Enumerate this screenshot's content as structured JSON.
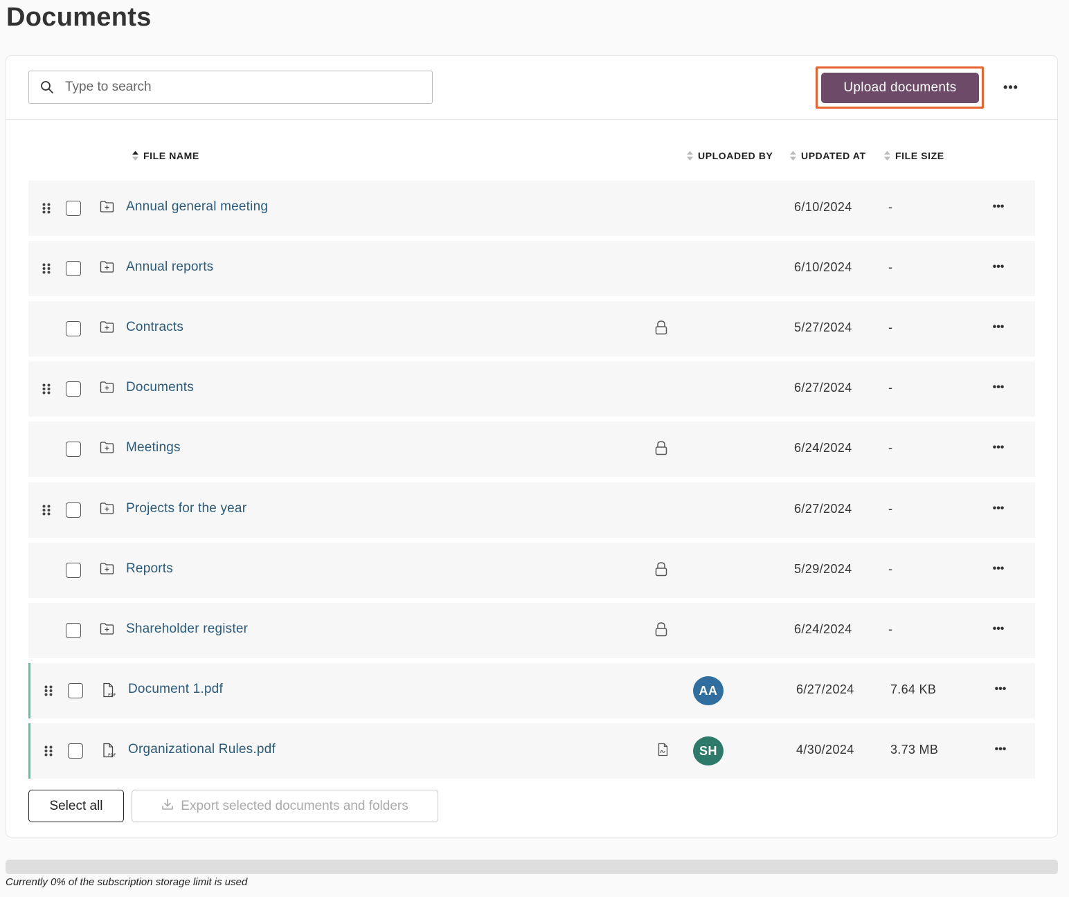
{
  "page": {
    "title": "Documents"
  },
  "toolbar": {
    "search_placeholder": "Type to search",
    "upload_label": "Upload documents",
    "more_label": "•••"
  },
  "table": {
    "columns": {
      "file_name": "FILE NAME",
      "uploaded_by": "UPLOADED BY",
      "updated_at": "UPDATED AT",
      "file_size": "FILE SIZE"
    },
    "rows": [
      {
        "name": "Annual general meeting",
        "type": "folder",
        "draggable": true,
        "locked": false,
        "uploaded_by": "",
        "updated_at": "6/10/2024",
        "size": "-"
      },
      {
        "name": "Annual reports",
        "type": "folder",
        "draggable": true,
        "locked": false,
        "uploaded_by": "",
        "updated_at": "6/10/2024",
        "size": "-"
      },
      {
        "name": "Contracts",
        "type": "folder",
        "draggable": false,
        "locked": true,
        "uploaded_by": "",
        "updated_at": "5/27/2024",
        "size": "-"
      },
      {
        "name": "Documents",
        "type": "folder",
        "draggable": true,
        "locked": false,
        "uploaded_by": "",
        "updated_at": "6/27/2024",
        "size": "-"
      },
      {
        "name": "Meetings",
        "type": "folder",
        "draggable": false,
        "locked": true,
        "uploaded_by": "",
        "updated_at": "6/24/2024",
        "size": "-"
      },
      {
        "name": "Projects for the year",
        "type": "folder",
        "draggable": true,
        "locked": false,
        "uploaded_by": "",
        "updated_at": "6/27/2024",
        "size": "-"
      },
      {
        "name": "Reports",
        "type": "folder",
        "draggable": false,
        "locked": true,
        "uploaded_by": "",
        "updated_at": "5/29/2024",
        "size": "-"
      },
      {
        "name": "Shareholder register",
        "type": "folder",
        "draggable": false,
        "locked": true,
        "uploaded_by": "",
        "updated_at": "6/24/2024",
        "size": "-"
      },
      {
        "name": "Document 1.pdf",
        "type": "pdf",
        "draggable": true,
        "locked": false,
        "uploaded_by": "AA",
        "avatar_color": "#2f6e9e",
        "updated_at": "6/27/2024",
        "size": "7.64 KB"
      },
      {
        "name": "Organizational Rules.pdf",
        "type": "pdf",
        "draggable": true,
        "locked": false,
        "signed": true,
        "uploaded_by": "SH",
        "avatar_color": "#2e7a6a",
        "updated_at": "4/30/2024",
        "size": "3.73 MB"
      }
    ]
  },
  "footer": {
    "select_all_label": "Select all",
    "export_label": "Export selected documents and folders"
  },
  "storage": {
    "used_fraction": 0,
    "text": "Currently 0% of the subscription storage limit is used"
  },
  "colors": {
    "accent": "#6c4a68",
    "highlight": "#e8642c",
    "link": "#2a5a7c",
    "file_marker": "#5cc3a6"
  }
}
